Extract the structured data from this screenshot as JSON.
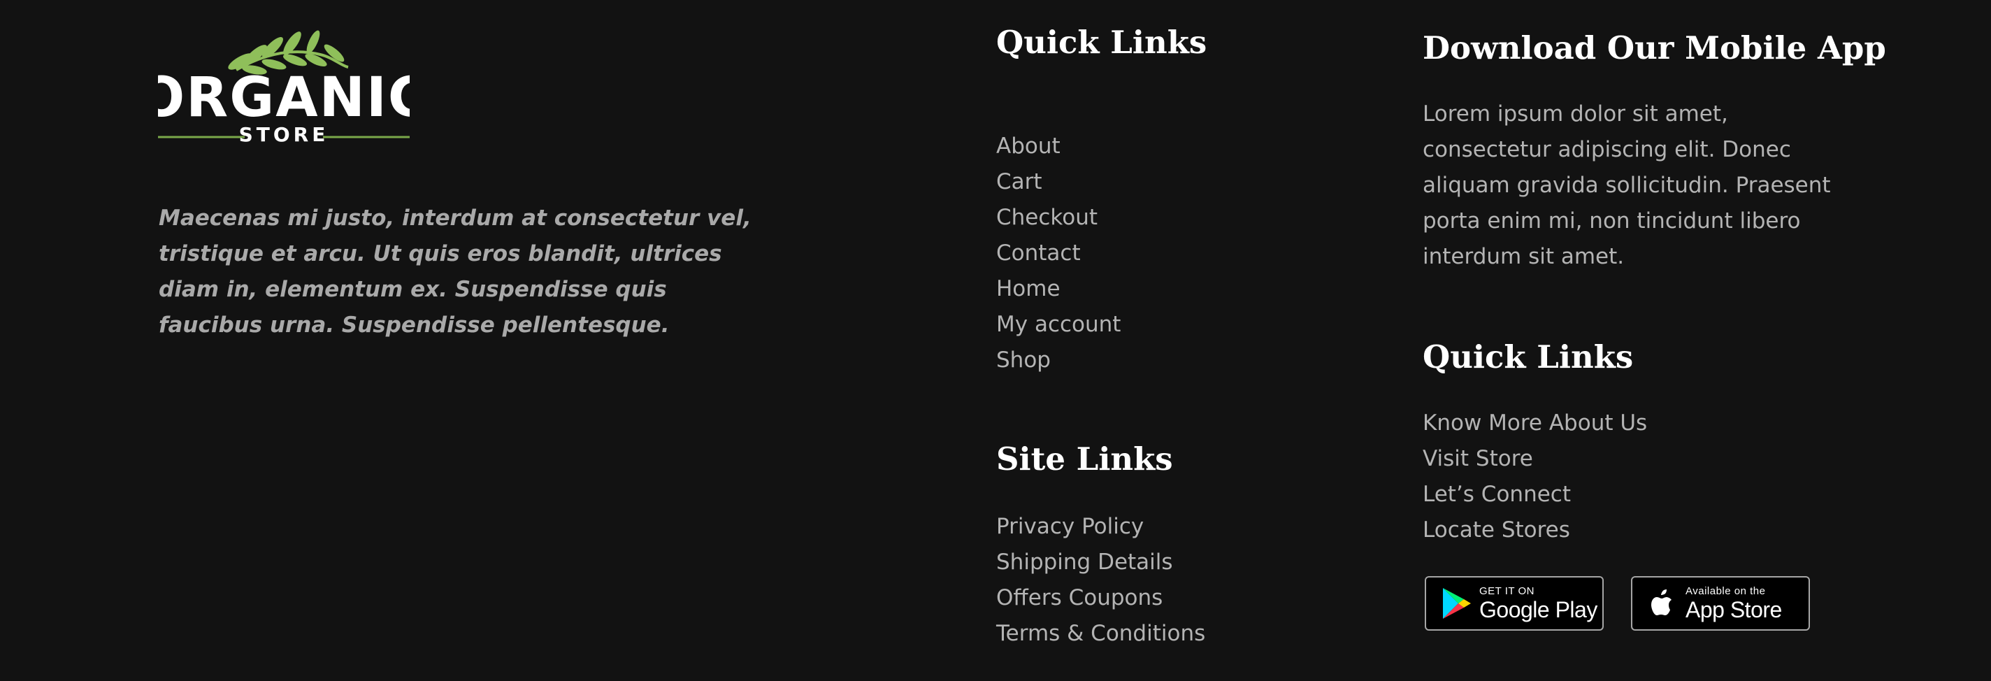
{
  "brand": {
    "logo_word": "ORGANIC",
    "logo_sub": "STORE",
    "description": "Maecenas mi justo, interdum at consectetur vel, tristique et arcu. Ut quis eros blandit, ultrices diam in, elementum ex. Suspendisse quis faucibus urna. Suspendisse pellentesque.",
    "leaf_color": "#8fbf5a",
    "accent_line_color": "#7aa84a"
  },
  "quick_links": {
    "heading": "Quick Links",
    "items": [
      "About",
      "Cart",
      "Checkout",
      "Contact",
      "Home",
      "My account",
      "Shop"
    ]
  },
  "site_links": {
    "heading": "Site Links",
    "items": [
      "Privacy Policy",
      "Shipping Details",
      "Offers Coupons",
      "Terms & Conditions"
    ]
  },
  "mobile_app": {
    "heading": "Download Our Mobile App",
    "description": "Lorem ipsum dolor sit amet, consectetur adipiscing elit. Donec aliquam gravida sollicitudin. Praesent porta enim mi, non tincidunt libero interdum sit amet."
  },
  "quick_links_2": {
    "heading": "Quick Links",
    "items": [
      "Know More About Us",
      "Visit Store",
      "Let’s Connect",
      "Locate Stores"
    ]
  },
  "badges": {
    "google": {
      "small": "GET IT ON",
      "big": "Google Play",
      "icon": "google-play-icon"
    },
    "apple": {
      "small": "Available on the",
      "big": "App Store",
      "icon": "apple-icon"
    }
  },
  "colors": {
    "background": "#121212",
    "heading": "#ffffff",
    "text": "#b4b4b4"
  }
}
